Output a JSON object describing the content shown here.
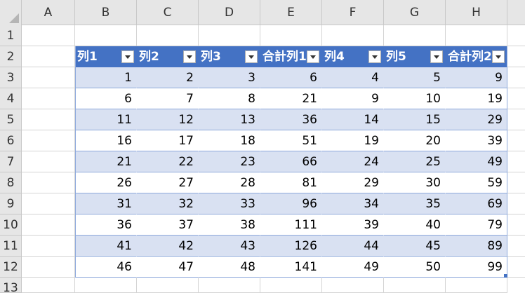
{
  "sheet": {
    "columns": [
      "A",
      "B",
      "C",
      "D",
      "E",
      "F",
      "G",
      "H"
    ],
    "rows": [
      "1",
      "2",
      "3",
      "4",
      "5",
      "6",
      "7",
      "8",
      "9",
      "10",
      "11",
      "12",
      "13"
    ]
  },
  "table": {
    "headers": [
      "列1",
      "列2",
      "列3",
      "合計列1",
      "列4",
      "列5",
      "合計列2"
    ],
    "rows": [
      [
        "1",
        "2",
        "3",
        "6",
        "4",
        "5",
        "9"
      ],
      [
        "6",
        "7",
        "8",
        "21",
        "9",
        "10",
        "19"
      ],
      [
        "11",
        "12",
        "13",
        "36",
        "14",
        "15",
        "29"
      ],
      [
        "16",
        "17",
        "18",
        "51",
        "19",
        "20",
        "39"
      ],
      [
        "21",
        "22",
        "23",
        "66",
        "24",
        "25",
        "49"
      ],
      [
        "26",
        "27",
        "28",
        "81",
        "29",
        "30",
        "59"
      ],
      [
        "31",
        "32",
        "33",
        "96",
        "34",
        "35",
        "69"
      ],
      [
        "36",
        "37",
        "38",
        "111",
        "39",
        "40",
        "79"
      ],
      [
        "41",
        "42",
        "43",
        "126",
        "44",
        "45",
        "89"
      ],
      [
        "46",
        "47",
        "48",
        "141",
        "49",
        "50",
        "99"
      ]
    ]
  },
  "colors": {
    "header_fill": "#4472c4",
    "band_fill": "#d9e1f2",
    "gridline": "#d4d4d4",
    "sheet_header_fill": "#e6e6e6"
  }
}
